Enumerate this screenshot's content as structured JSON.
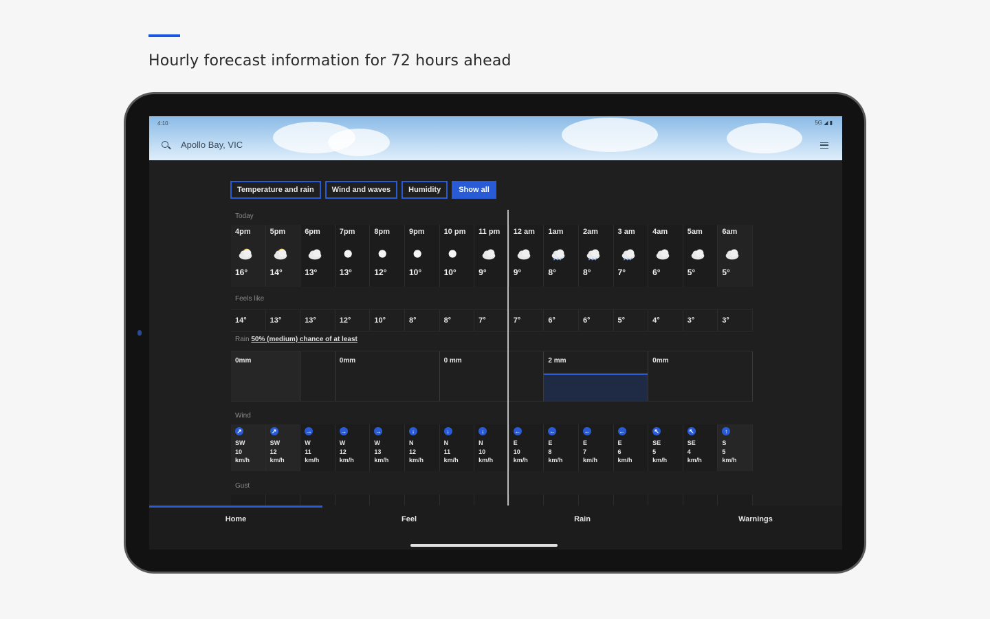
{
  "page": {
    "headline": "Hourly forecast information for 72 hours ahead"
  },
  "app": {
    "status_time": "4:10",
    "status_icons": "5G ◢ ▮",
    "location": "Apollo Bay, VIC"
  },
  "filters": [
    {
      "label": "Temperature and rain",
      "active": false
    },
    {
      "label": "Wind and waves",
      "active": false
    },
    {
      "label": "Humidity",
      "active": false
    },
    {
      "label": "Show all",
      "active": true
    }
  ],
  "forecast": {
    "day_label": "Today",
    "hours": [
      {
        "time": "4pm",
        "icon": "partly-cloudy-sun-icon",
        "temp": "16°"
      },
      {
        "time": "5pm",
        "icon": "partly-cloudy-sun-icon",
        "temp": "14°"
      },
      {
        "time": "6pm",
        "icon": "cloudy-icon",
        "temp": "13°"
      },
      {
        "time": "7pm",
        "icon": "clear-night-icon",
        "temp": "13°"
      },
      {
        "time": "8pm",
        "icon": "clear-night-icon",
        "temp": "12°"
      },
      {
        "time": "9pm",
        "icon": "clear-night-icon",
        "temp": "10°"
      },
      {
        "time": "10 pm",
        "icon": "clear-night-icon",
        "temp": "10°"
      },
      {
        "time": "11 pm",
        "icon": "cloudy-icon",
        "temp": "9°"
      },
      {
        "time": "12 am",
        "icon": "cloudy-icon",
        "temp": "9°"
      },
      {
        "time": "1am",
        "icon": "showers-icon",
        "temp": "8°"
      },
      {
        "time": "2am",
        "icon": "showers-icon",
        "temp": "8°"
      },
      {
        "time": "3 am",
        "icon": "showers-icon",
        "temp": "7°"
      },
      {
        "time": "4am",
        "icon": "cloudy-icon",
        "temp": "6°"
      },
      {
        "time": "5am",
        "icon": "cloudy-icon",
        "temp": "5°"
      },
      {
        "time": "6am",
        "icon": "partly-cloudy-night-icon",
        "temp": "5°"
      }
    ],
    "feels_like_label": "Feels like",
    "feels_like": [
      "14°",
      "13°",
      "13°",
      "12°",
      "10°",
      "8°",
      "8°",
      "7°",
      "7°",
      "6°",
      "6°",
      "5°",
      "4°",
      "3°",
      "3°"
    ],
    "rain_label": "Rain",
    "rain_caption": "50% (medium) chance of at least",
    "rain_blocks": [
      {
        "label": "0mm",
        "span": 2
      },
      {
        "label": "",
        "span": 1
      },
      {
        "label": "0mm",
        "span": 3
      },
      {
        "label": "0 mm",
        "span": 3
      },
      {
        "label": "2 mm",
        "span": 3,
        "bar": true
      },
      {
        "label": "0mm",
        "span": 3
      }
    ],
    "wind_label": "Wind",
    "wind": [
      {
        "dir": "SW",
        "speed": "10",
        "unit": "km/h",
        "arrow": "↗"
      },
      {
        "dir": "SW",
        "speed": "12",
        "unit": "km/h",
        "arrow": "↗"
      },
      {
        "dir": "W",
        "speed": "11",
        "unit": "km/h",
        "arrow": "→"
      },
      {
        "dir": "W",
        "speed": "12",
        "unit": "km/h",
        "arrow": "→"
      },
      {
        "dir": "W",
        "speed": "13",
        "unit": "km/h",
        "arrow": "→"
      },
      {
        "dir": "N",
        "speed": "12",
        "unit": "km/h",
        "arrow": "↓"
      },
      {
        "dir": "N",
        "speed": "11",
        "unit": "km/h",
        "arrow": "↓"
      },
      {
        "dir": "N",
        "speed": "10",
        "unit": "km/h",
        "arrow": "↓"
      },
      {
        "dir": "E",
        "speed": "10",
        "unit": "km/h",
        "arrow": "←"
      },
      {
        "dir": "E",
        "speed": "8",
        "unit": "km/h",
        "arrow": "←"
      },
      {
        "dir": "E",
        "speed": "7",
        "unit": "km/h",
        "arrow": "←"
      },
      {
        "dir": "E",
        "speed": "6",
        "unit": "km/h",
        "arrow": "←"
      },
      {
        "dir": "SE",
        "speed": "5",
        "unit": "km/h",
        "arrow": "↖"
      },
      {
        "dir": "SE",
        "speed": "4",
        "unit": "km/h",
        "arrow": "↖"
      },
      {
        "dir": "S",
        "speed": "5",
        "unit": "km/h",
        "arrow": "↑"
      }
    ],
    "gust_label": "Gust"
  },
  "nav": {
    "items": [
      "Home",
      "Feel",
      "Rain",
      "Warnings"
    ]
  },
  "colors": {
    "accent": "#2a5bd7",
    "background": "#1f1f1f"
  }
}
